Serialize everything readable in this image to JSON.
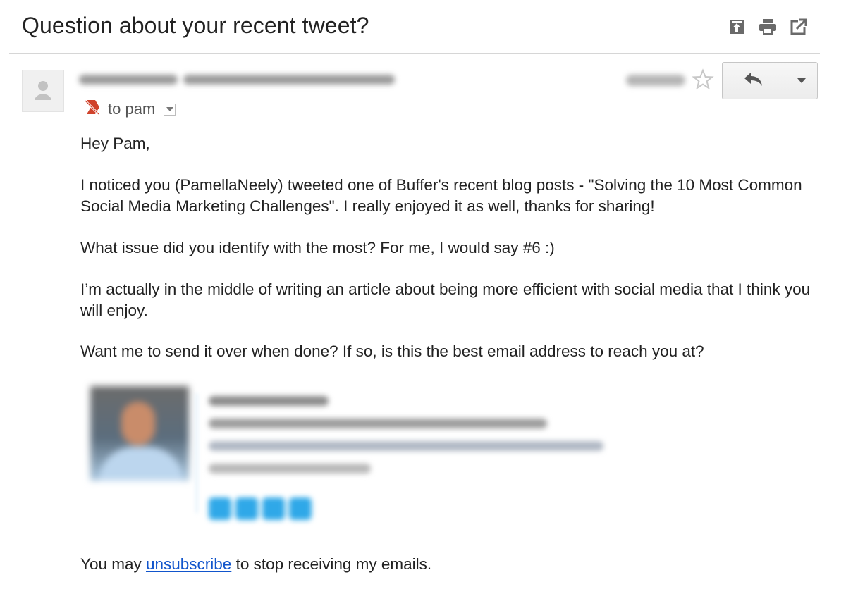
{
  "email": {
    "subject": "Question about your recent tweet?",
    "recipient_label": "to pam",
    "greeting": "Hey Pam,",
    "paragraphs": [
      "I noticed you (PamellaNeely) tweeted one of Buffer's recent blog posts - \"Solving the 10 Most Common Social Media Marketing Challenges\". I really enjoyed it as well, thanks for sharing!",
      "What issue did you identify with the most? For me, I would say #6 :)",
      "I’m actually in the middle of writing an article about being more efficient with social media that I think you will enjoy.",
      "Want me to send it over when done? If so, is this the best email address to reach you at?"
    ],
    "footer": {
      "prefix": "You may ",
      "link_text": "unsubscribe",
      "suffix": " to stop receiving my emails."
    }
  },
  "icons": {
    "top_toolbar": [
      "archive-up-icon",
      "print-icon",
      "new-window-icon"
    ],
    "sender": "avatar-icon",
    "star": "star-icon",
    "reply": "reply-arrow-icon",
    "more": "dropdown-arrow-icon",
    "not_important": "importance-marker-icon",
    "recipient_details": "chevron-down-icon"
  },
  "colors": {
    "link": "#1155cc",
    "text": "#222222",
    "muted": "#555555",
    "importance_marker": "#d0432c",
    "social_icons": "#2fa8e8"
  }
}
